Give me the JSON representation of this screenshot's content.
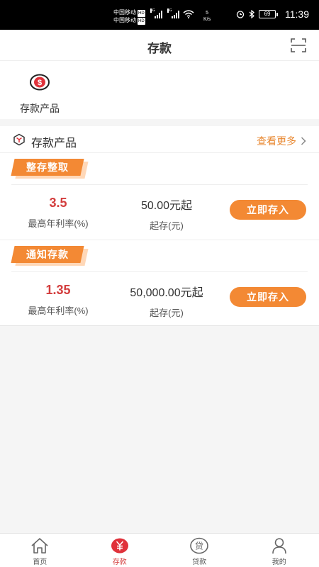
{
  "status_bar": {
    "carrier_line1": "中国移动",
    "carrier_line2": "中国移动",
    "hd_label": "HD",
    "net1": "5G",
    "net2": "4G",
    "speed_value": "5",
    "speed_unit": "K/s",
    "battery": "69",
    "time": "11:39"
  },
  "header": {
    "title": "存款"
  },
  "categories": [
    {
      "label": "存款产品",
      "icon": "dollar-coin-icon"
    }
  ],
  "section": {
    "title": "存款产品",
    "more_label": "查看更多"
  },
  "products": [
    {
      "tag": "整存整取",
      "rate": "3.5",
      "rate_label": "最高年利率(%)",
      "min_amount": "50.00元起",
      "min_label": "起存(元)",
      "button": "立即存入"
    },
    {
      "tag": "通知存款",
      "rate": "1.35",
      "rate_label": "最高年利率(%)",
      "min_amount": "50,000.00元起",
      "min_label": "起存(元)",
      "button": "立即存入"
    }
  ],
  "tabbar": {
    "tabs": [
      {
        "label": "首页",
        "icon": "home-icon",
        "active": false
      },
      {
        "label": "存款",
        "icon": "yuan-icon",
        "active": true
      },
      {
        "label": "贷款",
        "icon": "loan-icon",
        "active": false
      },
      {
        "label": "我的",
        "icon": "user-icon",
        "active": false
      }
    ]
  },
  "colors": {
    "accent_orange": "#f38934",
    "rate_red": "#d33d3d",
    "status_bar": "#000000"
  }
}
